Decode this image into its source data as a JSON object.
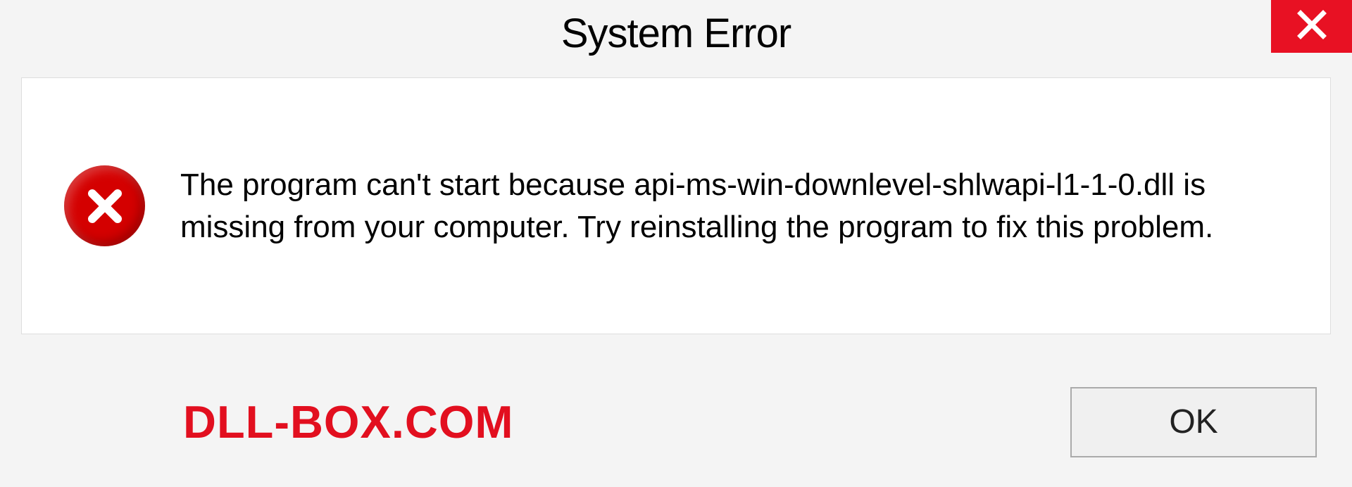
{
  "titlebar": {
    "title": "System Error"
  },
  "dialog": {
    "message": "The program can't start because api-ms-win-downlevel-shlwapi-l1-1-0.dll is missing from your computer. Try reinstalling the program to fix this problem."
  },
  "footer": {
    "watermark": "DLL-BOX.COM",
    "ok_label": "OK"
  },
  "colors": {
    "close_bg": "#e81123",
    "error_icon": "#d40000",
    "watermark": "#e20f1f"
  }
}
